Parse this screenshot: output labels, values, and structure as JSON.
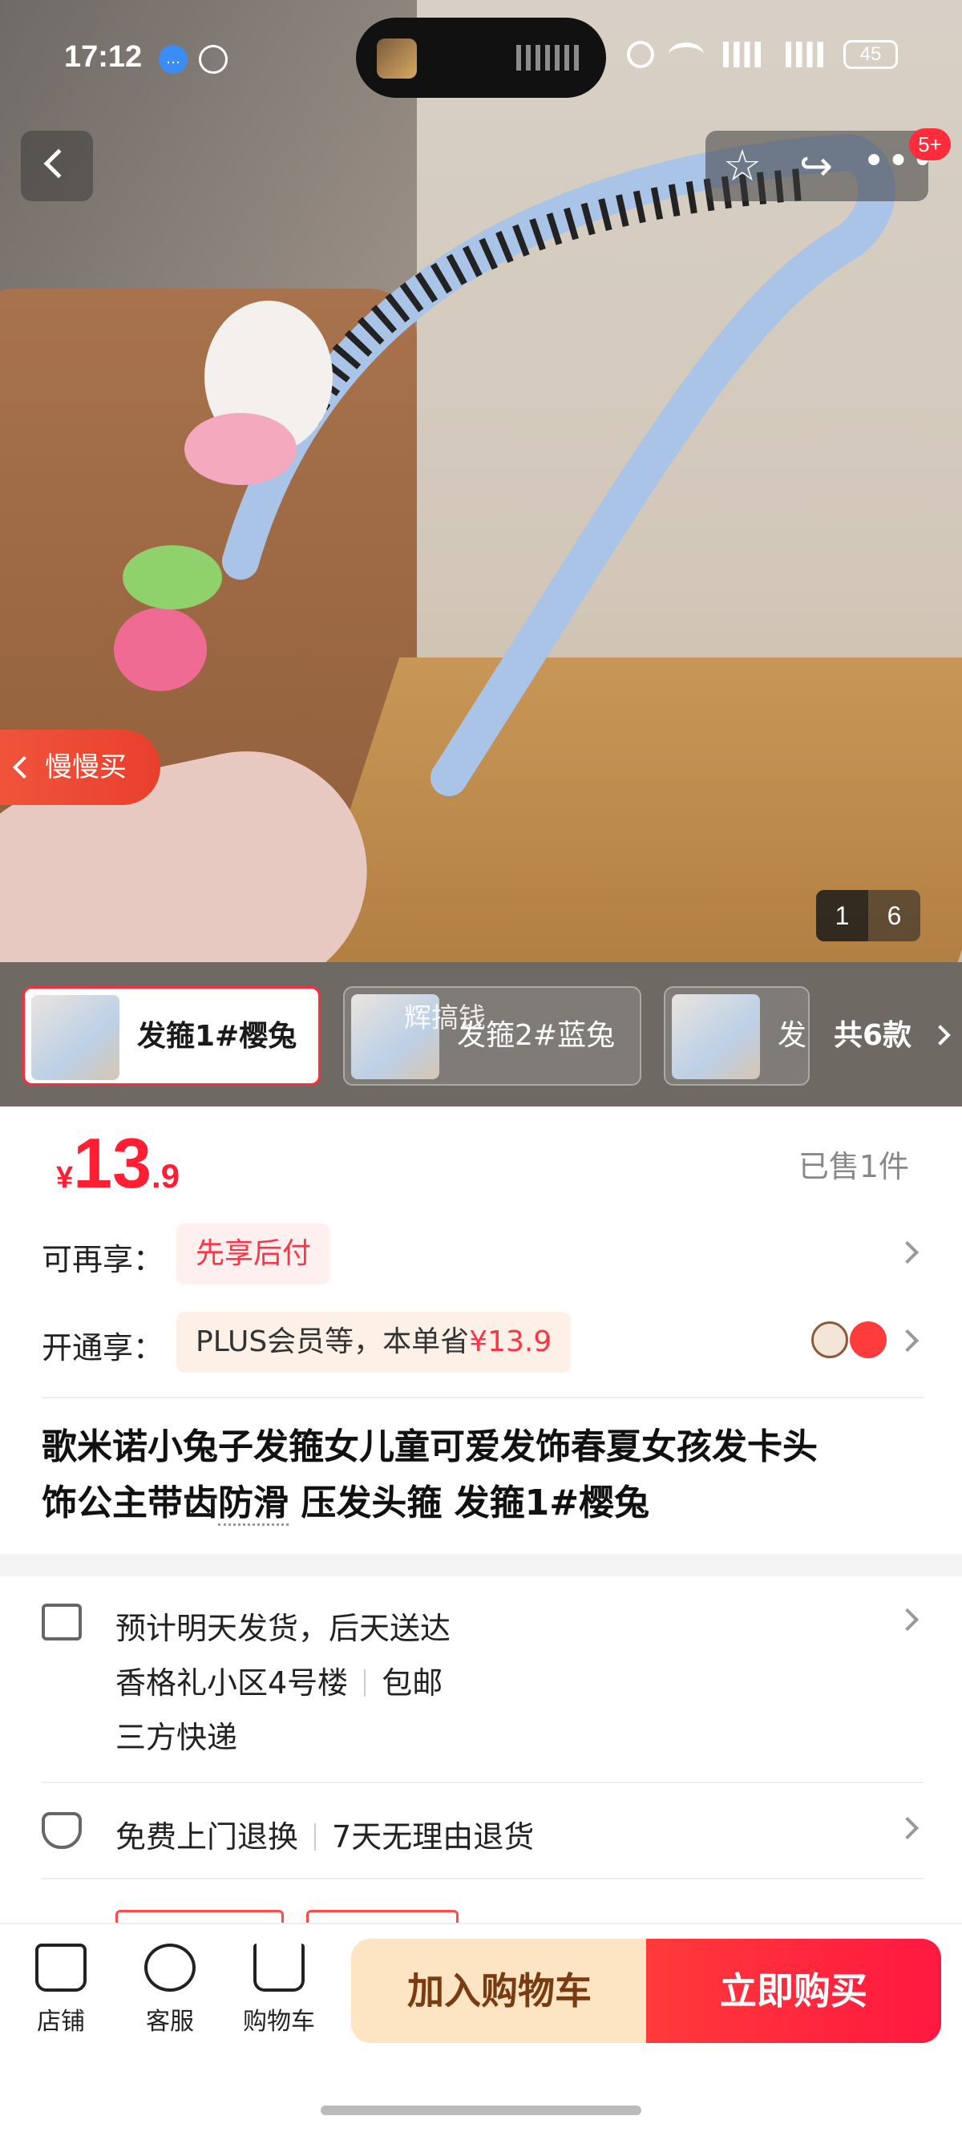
{
  "status_bar": {
    "time": "17:12",
    "battery": "45",
    "icons": [
      "message-icon",
      "shield-icon",
      "alarm-icon",
      "wifi-icon",
      "5g-signal-icon",
      "5g-signal-icon"
    ]
  },
  "nav": {
    "badge": "5+",
    "icons": [
      "back-icon",
      "star-icon",
      "share-icon",
      "more-icon"
    ]
  },
  "hero": {
    "slow_buy_label": "慢慢买",
    "current_index": "1",
    "total_images": "6"
  },
  "variants": {
    "items": [
      {
        "label": "发箍1#樱兔",
        "active": true
      },
      {
        "label": "发箍2#蓝兔",
        "active": false,
        "overlay": "辉搞钱"
      },
      {
        "label": "发",
        "active": false
      }
    ],
    "total_label": "共6款"
  },
  "price": {
    "symbol": "¥",
    "integer": "13",
    "decimal": ".9",
    "sold": "已售1件"
  },
  "benefits": [
    {
      "label": "可再享：",
      "chip": "先享后付"
    },
    {
      "label": "开通享：",
      "chip_prefix": "PLUS会员等，本单省",
      "chip_value": "¥13.9"
    }
  ],
  "title": {
    "line1": "歌米诺小兔子发箍女儿童可爱发饰春夏女孩发卡头",
    "line2_a": "饰公主带齿",
    "line2_dotted": "防滑",
    "line2_b": " 压发头箍 发箍1#樱兔"
  },
  "shipping": {
    "line1": "预计明天发货，后天送达",
    "address": "香格礼小区4号楼",
    "free_shipping": "包邮",
    "carrier": "三方快递"
  },
  "returns": {
    "item1": "免费上门退换",
    "item2": "7天无理由退货"
  },
  "bottom_bar": {
    "store": "店铺",
    "service": "客服",
    "cart": "购物车",
    "add_to_cart": "加入购物车",
    "buy_now": "立即购买"
  },
  "colors": {
    "accent_red": "#ff1e32",
    "add_cart_bg": "#fde5c4",
    "buy_now_bg": "#ff2a3c"
  }
}
